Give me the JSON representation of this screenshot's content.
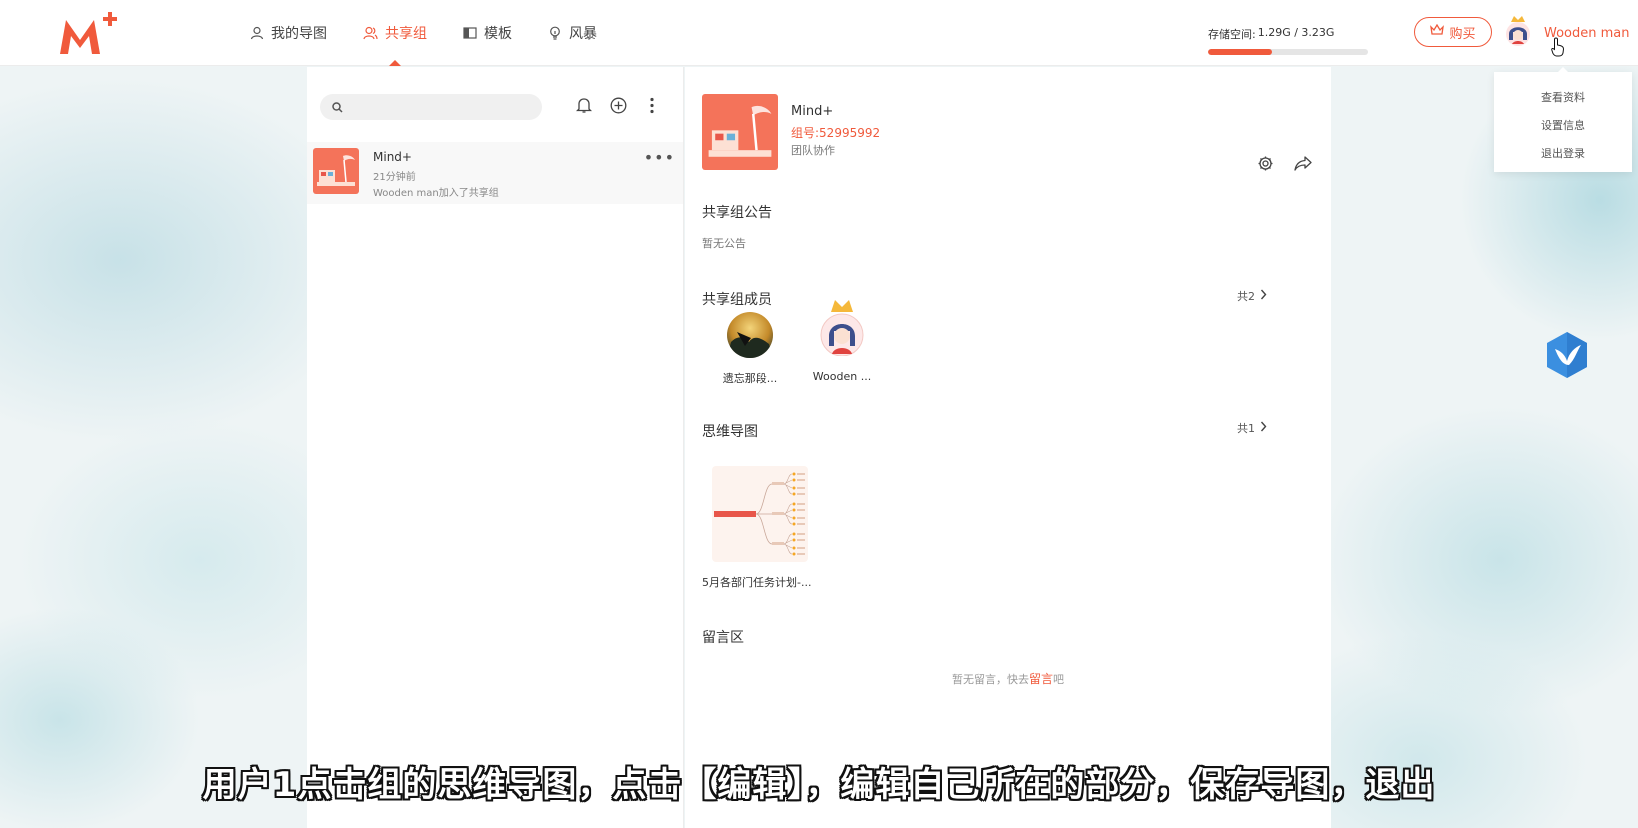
{
  "nav": {
    "items": [
      {
        "label": "我的导图",
        "icon": "person-icon",
        "active": false
      },
      {
        "label": "共享组",
        "icon": "group-icon",
        "active": true
      },
      {
        "label": "模板",
        "icon": "template-icon",
        "active": false
      },
      {
        "label": "风暴",
        "icon": "bulb-icon",
        "active": false
      }
    ]
  },
  "storage": {
    "label": "存储空间:",
    "value": "1.29G / 3.23G",
    "fraction": 0.4
  },
  "buy_label": "购买",
  "user": {
    "name": "Wooden man"
  },
  "user_menu": [
    "查看资料",
    "设置信息",
    "退出登录"
  ],
  "search": {
    "placeholder": ""
  },
  "group_list": [
    {
      "name": "Mind+",
      "time": "21分钟前",
      "message": "Wooden man加入了共享组"
    }
  ],
  "group_detail": {
    "name": "Mind+",
    "id": "组号:52995992",
    "type": "团队协作",
    "announcement_title": "共享组公告",
    "announcement": "暂无公告",
    "members_title": "共享组成员",
    "members_count": "共2",
    "members": [
      {
        "name": "遗忘那段..."
      },
      {
        "name": "Wooden ..."
      }
    ],
    "mindmaps_title": "思维导图",
    "mindmaps_count": "共1",
    "mindmaps": [
      {
        "name": "5月各部门任务计划-..."
      }
    ],
    "comments_title": "留言区",
    "comments_empty_prefix": "暂无留言，快去",
    "comments_empty_link": "留言",
    "comments_empty_suffix": "吧"
  },
  "subtitle": "用户1点击组的思维导图，点击【编辑】，编辑自己所在的部分，保存导图，退出",
  "colors": {
    "accent": "#f05a3c"
  }
}
